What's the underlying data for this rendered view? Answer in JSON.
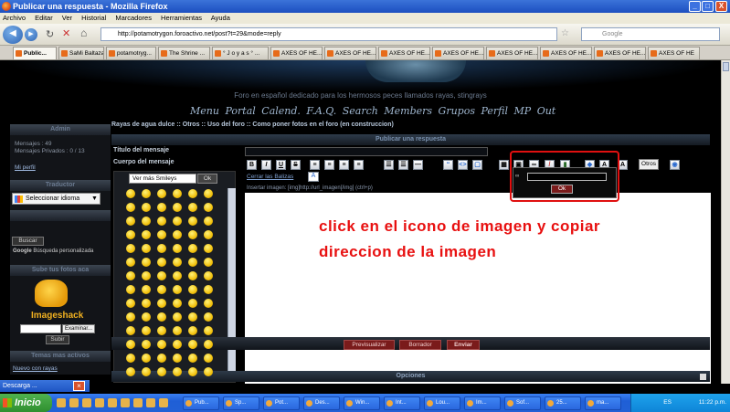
{
  "window": {
    "title": "Publicar una respuesta - Mozilla Firefox",
    "controls": [
      "_",
      "□",
      "X"
    ]
  },
  "menu": [
    "Archivo",
    "Editar",
    "Ver",
    "Historial",
    "Marcadores",
    "Herramientas",
    "Ayuda"
  ],
  "nav": {
    "url": "http://potamotrygon.foroactivo.net/post?t=29&mode=reply",
    "search_placeholder": "Google"
  },
  "tabs": [
    "Public...",
    "SaMi Baltazar",
    "potamotryg...",
    "The Shrine ...",
    "° J o y a s ° ...",
    "AXES OF HE...",
    "AXES OF HE...",
    "AXES OF HE...",
    "AXES OF HE...",
    "AXES OF HE...",
    "AXES OF HE...",
    "AXES OF HE...",
    "AXES OF HE"
  ],
  "site": {
    "tagline": "Foro en español dedicado para los hermosos peces llamados rayas, stingrays",
    "nav": [
      "Menu",
      "Portal",
      "Calend.",
      "F.A.Q.",
      "Search",
      "Members",
      "Grupos",
      "Perfil",
      "MP",
      "Out"
    ]
  },
  "sidebar": {
    "user_header": "Admin",
    "mensajes": "Mensajes : 49",
    "privados": "Mensajes Privados : 0 / 13",
    "mi_perfil": "Mi perfil",
    "traductor": "Traductor",
    "idioma": "Seleccionar idioma",
    "buscar": "Buscar",
    "google_search": "Búsqueda personalizada",
    "fotos_header": "Sube tus fotos aca",
    "imageshack": "Imageshack",
    "examinar": "Examinar...",
    "subir": "Subir",
    "temas_header": "Temas mas activos",
    "nuevo": "Nuevo con rayas"
  },
  "main": {
    "breadcrumb": "Rayas de agua dulce :: Otros :: Uso del foro :: Como poner fotos en el foro (en construccion)",
    "header": "Publicar una respuesta",
    "titulo_label": "Título del mensaje",
    "cuerpo_label": "Cuerpo del mensaje",
    "smileys_select": "Ver más Smileys",
    "smileys_ok": "Ok",
    "cerrar_balizas": "Cerrar las Balizas",
    "insertar_imagen": "Insertar imagen: [img]http://url_imagen[/img] (ctrl+p)",
    "otros": "Otros",
    "popup_ok": "Ok",
    "annotation_line1": "click en el icono de imagen y copiar",
    "annotation_line2": "direccion de la imagen",
    "previsualizar": "Previsualizar",
    "borrador": "Borrador",
    "enviar": "Enviar",
    "opciones": "Opciones",
    "toolbar_labels": [
      "B",
      "I",
      "U",
      "S"
    ]
  },
  "download": {
    "title": "Descarga ..."
  },
  "taskbar": {
    "start": "Inicio",
    "tasks": [
      "Pub...",
      "Sp...",
      "Pot...",
      "Des...",
      "Win...",
      "Int...",
      "Lou...",
      "Im...",
      "Sof...",
      "25...",
      "ma..."
    ],
    "lang": "ES",
    "clock": "11:22 p.m."
  }
}
